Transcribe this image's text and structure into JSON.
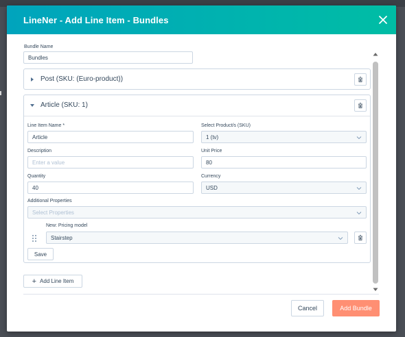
{
  "modal": {
    "title": "LineNer - Add Line Item - Bundles",
    "close_icon": "close-icon"
  },
  "bundle": {
    "name_label": "Bundle Name",
    "name_value": "Bundles"
  },
  "line_items": [
    {
      "title": "Post (SKU: (Euro-product))",
      "expanded": false
    },
    {
      "title": "Article (SKU: 1)",
      "expanded": true,
      "fields": {
        "line_item_name_label": "Line Item Name *",
        "line_item_name_value": "Article",
        "select_products_label": "Select Product/s (SKU)",
        "select_products_value": "1 (tv)",
        "description_label": "Description",
        "description_placeholder": "Enter a value",
        "unit_price_label": "Unit Price",
        "unit_price_value": "80",
        "quantity_label": "Quantity",
        "quantity_value": "40",
        "currency_label": "Currency",
        "currency_value": "USD",
        "additional_properties_label": "Additional Properties",
        "additional_properties_placeholder": "Select Properties",
        "property_label": "New: Pricing model",
        "property_value": "Stairstep",
        "save_label": "Save"
      }
    }
  ],
  "add_line_item_label": "Add Line Item",
  "footer": {
    "cancel_label": "Cancel",
    "add_bundle_label": "Add Bundle"
  },
  "colors": {
    "header_start": "#00a4bd",
    "header_end": "#00bda5",
    "primary_button": "#ff8f73"
  }
}
